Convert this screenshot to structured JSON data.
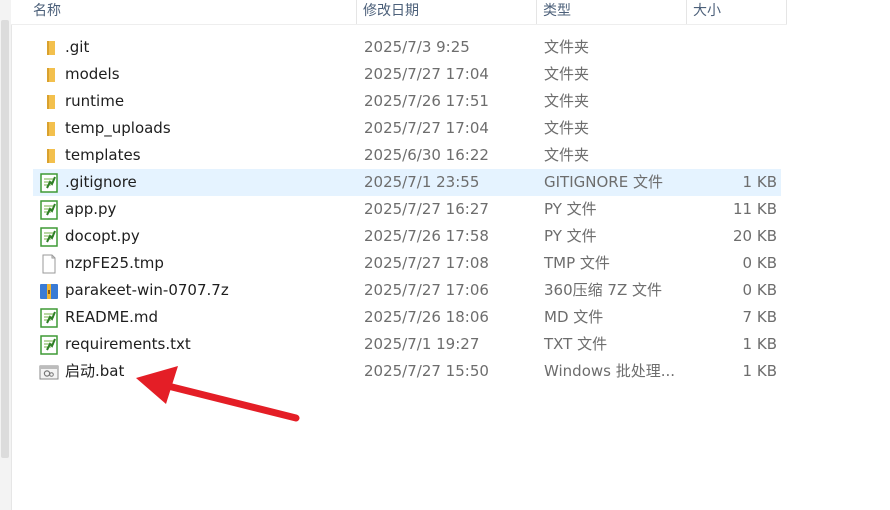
{
  "columns": {
    "name": "名称",
    "date": "修改日期",
    "type": "类型",
    "size": "大小"
  },
  "files": [
    {
      "name": ".git",
      "date": "2025/7/3 9:25",
      "type": "文件夹",
      "size": "",
      "icon": "folder-icon"
    },
    {
      "name": "models",
      "date": "2025/7/27 17:04",
      "type": "文件夹",
      "size": "",
      "icon": "folder-icon"
    },
    {
      "name": "runtime",
      "date": "2025/7/26 17:51",
      "type": "文件夹",
      "size": "",
      "icon": "folder-icon"
    },
    {
      "name": "temp_uploads",
      "date": "2025/7/27 17:04",
      "type": "文件夹",
      "size": "",
      "icon": "folder-icon"
    },
    {
      "name": "templates",
      "date": "2025/6/30 16:22",
      "type": "文件夹",
      "size": "",
      "icon": "folder-icon"
    },
    {
      "name": ".gitignore",
      "date": "2025/7/1 23:55",
      "type": "GITIGNORE 文件",
      "size": "1 KB",
      "icon": "text-document-icon",
      "selected": true
    },
    {
      "name": "app.py",
      "date": "2025/7/27 16:27",
      "type": "PY 文件",
      "size": "11 KB",
      "icon": "text-document-icon"
    },
    {
      "name": "docopt.py",
      "date": "2025/7/26 17:58",
      "type": "PY 文件",
      "size": "20 KB",
      "icon": "text-document-icon"
    },
    {
      "name": "nzpFE25.tmp",
      "date": "2025/7/27 17:08",
      "type": "TMP 文件",
      "size": "0 KB",
      "icon": "blank-file-icon"
    },
    {
      "name": "parakeet-win-0707.7z",
      "date": "2025/7/27 17:06",
      "type": "360压缩 7Z 文件",
      "size": "0 KB",
      "icon": "archive-icon"
    },
    {
      "name": "README.md",
      "date": "2025/7/26 18:06",
      "type": "MD 文件",
      "size": "7 KB",
      "icon": "text-document-icon"
    },
    {
      "name": "requirements.txt",
      "date": "2025/7/1 19:27",
      "type": "TXT 文件",
      "size": "1 KB",
      "icon": "text-document-icon"
    },
    {
      "name": "启动.bat",
      "date": "2025/7/27 15:50",
      "type": "Windows 批处理...",
      "size": "1 KB",
      "icon": "batch-file-icon"
    }
  ],
  "colors": {
    "selection": "#e5f3ff",
    "folder": "#f3c04d",
    "doc_green": "#3e9a35",
    "archive_blue": "#3a7bd5",
    "arrow": "#e41e26"
  }
}
